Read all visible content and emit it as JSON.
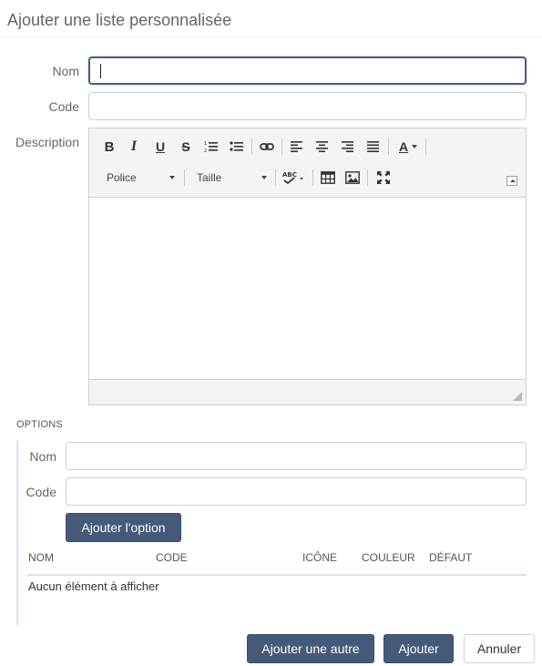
{
  "dialog": {
    "title": "Ajouter une liste personnalisée"
  },
  "form": {
    "nom_label": "Nom",
    "nom_value": "",
    "code_label": "Code",
    "code_value": "",
    "description_label": "Description"
  },
  "editor": {
    "font_combo": "Police",
    "size_combo": "Taille",
    "text_color_glyph": "A",
    "toolbar_icons": [
      "bold-icon",
      "italic-icon",
      "underline-icon",
      "strikethrough-icon",
      "numbered-list-icon",
      "bulleted-list-icon",
      "link-icon",
      "align-left-icon",
      "align-center-icon",
      "align-right-icon",
      "align-justify-icon",
      "text-color-icon",
      "spellcheck-icon",
      "table-icon",
      "image-icon",
      "maximize-icon"
    ],
    "content": ""
  },
  "options": {
    "section_title": "OPTIONS",
    "nom_label": "Nom",
    "code_label": "Code",
    "add_button": "Ajouter l'option",
    "columns": [
      "NOM",
      "CODE",
      "ICÔNE",
      "COULEUR",
      "DÉFAUT"
    ],
    "empty_message": "Aucun élément à afficher"
  },
  "footer": {
    "add_another": "Ajouter une autre",
    "add": "Ajouter",
    "cancel": "Annuler"
  },
  "colors": {
    "primary": "#455a79",
    "focus_border": "#4a5f7f",
    "rail": "#d6e4ea"
  }
}
